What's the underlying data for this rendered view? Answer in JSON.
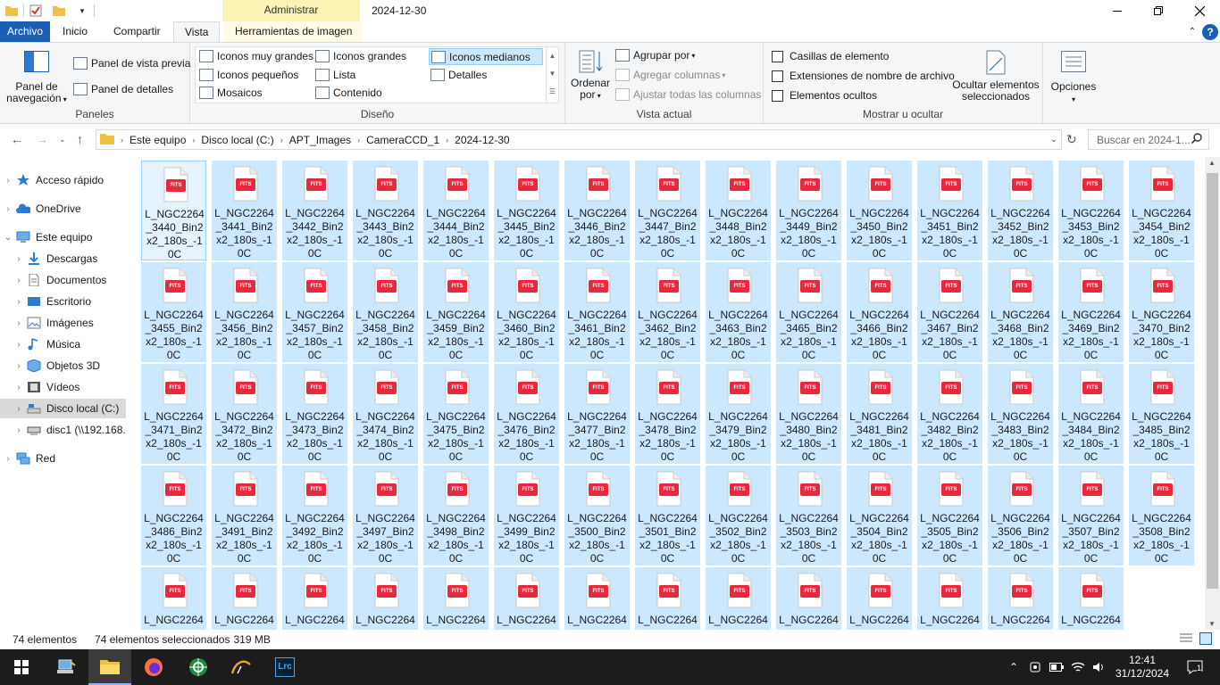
{
  "title": {
    "context_tab": "Administrar",
    "window_title": "2024-12-30"
  },
  "tabs": [
    {
      "label": "Archivo"
    },
    {
      "label": "Inicio"
    },
    {
      "label": "Compartir"
    },
    {
      "label": "Vista"
    },
    {
      "label": "Herramientas de imagen"
    }
  ],
  "ribbon": {
    "panels": {
      "label": "Paneles",
      "nav_pane": "Panel de navegación",
      "preview": "Panel de vista previa",
      "details": "Panel de detalles"
    },
    "layout": {
      "label": "Diseño",
      "items": [
        "Iconos muy grandes",
        "Iconos grandes",
        "Iconos medianos",
        "Iconos pequeños",
        "Lista",
        "Detalles",
        "Mosaicos",
        "Contenido"
      ]
    },
    "current_view": {
      "label": "Vista actual",
      "sort": "Ordenar por",
      "group": "Agrupar por",
      "add_columns": "Agregar columnas",
      "fit_columns": "Ajustar todas las columnas"
    },
    "show_hide": {
      "label": "Mostrar u ocultar",
      "checkboxes": [
        "Casillas de elemento",
        "Extensiones de nombre de archivo",
        "Elementos ocultos"
      ],
      "hide_selected": "Ocultar elementos seleccionados"
    },
    "options": "Opciones"
  },
  "address": {
    "crumbs": [
      "Este equipo",
      "Disco local (C:)",
      "APT_Images",
      "CameraCCD_1",
      "2024-12-30"
    ],
    "search_placeholder": "Buscar en 2024-1..."
  },
  "nav": [
    {
      "label": "Acceso rápido",
      "level": 0
    },
    {
      "label": "OneDrive",
      "level": 0
    },
    {
      "label": "Este equipo",
      "level": 0
    },
    {
      "label": "Descargas",
      "level": 1
    },
    {
      "label": "Documentos",
      "level": 1
    },
    {
      "label": "Escritorio",
      "level": 1
    },
    {
      "label": "Imágenes",
      "level": 1
    },
    {
      "label": "Música",
      "level": 1
    },
    {
      "label": "Objetos 3D",
      "level": 1
    },
    {
      "label": "Vídeos",
      "level": 1
    },
    {
      "label": "Disco local (C:)",
      "level": 1
    },
    {
      "label": "disc1 (\\\\192.168.",
      "level": 1
    },
    {
      "label": "Red",
      "level": 0
    }
  ],
  "file_icon_label": "FITS",
  "files": [
    "L_NGC2264_3440_Bin2x2_180s_-10C",
    "L_NGC2264_3441_Bin2x2_180s_-10C",
    "L_NGC2264_3442_Bin2x2_180s_-10C",
    "L_NGC2264_3443_Bin2x2_180s_-10C",
    "L_NGC2264_3444_Bin2x2_180s_-10C",
    "L_NGC2264_3445_Bin2x2_180s_-10C",
    "L_NGC2264_3446_Bin2x2_180s_-10C",
    "L_NGC2264_3447_Bin2x2_180s_-10C",
    "L_NGC2264_3448_Bin2x2_180s_-10C",
    "L_NGC2264_3449_Bin2x2_180s_-10C",
    "L_NGC2264_3450_Bin2x2_180s_-10C",
    "L_NGC2264_3451_Bin2x2_180s_-10C",
    "L_NGC2264_3452_Bin2x2_180s_-10C",
    "L_NGC2264_3453_Bin2x2_180s_-10C",
    "L_NGC2264_3454_Bin2x2_180s_-10C",
    "L_NGC2264_3455_Bin2x2_180s_-10C",
    "L_NGC2264_3456_Bin2x2_180s_-10C",
    "L_NGC2264_3457_Bin2x2_180s_-10C",
    "L_NGC2264_3458_Bin2x2_180s_-10C",
    "L_NGC2264_3459_Bin2x2_180s_-10C",
    "L_NGC2264_3460_Bin2x2_180s_-10C",
    "L_NGC2264_3461_Bin2x2_180s_-10C",
    "L_NGC2264_3462_Bin2x2_180s_-10C",
    "L_NGC2264_3463_Bin2x2_180s_-10C",
    "L_NGC2264_3465_Bin2x2_180s_-10C",
    "L_NGC2264_3466_Bin2x2_180s_-10C",
    "L_NGC2264_3467_Bin2x2_180s_-10C",
    "L_NGC2264_3468_Bin2x2_180s_-10C",
    "L_NGC2264_3469_Bin2x2_180s_-10C",
    "L_NGC2264_3470_Bin2x2_180s_-10C",
    "L_NGC2264_3471_Bin2x2_180s_-10C",
    "L_NGC2264_3472_Bin2x2_180s_-10C",
    "L_NGC2264_3473_Bin2x2_180s_-10C",
    "L_NGC2264_3474_Bin2x2_180s_-10C",
    "L_NGC2264_3475_Bin2x2_180s_-10C",
    "L_NGC2264_3476_Bin2x2_180s_-10C",
    "L_NGC2264_3477_Bin2x2_180s_-10C",
    "L_NGC2264_3478_Bin2x2_180s_-10C",
    "L_NGC2264_3479_Bin2x2_180s_-10C",
    "L_NGC2264_3480_Bin2x2_180s_-10C",
    "L_NGC2264_3481_Bin2x2_180s_-10C",
    "L_NGC2264_3482_Bin2x2_180s_-10C",
    "L_NGC2264_3483_Bin2x2_180s_-10C",
    "L_NGC2264_3484_Bin2x2_180s_-10C",
    "L_NGC2264_3485_Bin2x2_180s_-10C",
    "L_NGC2264_3486_Bin2x2_180s_-10C",
    "L_NGC2264_3491_Bin2x2_180s_-10C",
    "L_NGC2264_3492_Bin2x2_180s_-10C",
    "L_NGC2264_3497_Bin2x2_180s_-10C",
    "L_NGC2264_3498_Bin2x2_180s_-10C",
    "L_NGC2264_3499_Bin2x2_180s_-10C",
    "L_NGC2264_3500_Bin2x2_180s_-10C",
    "L_NGC2264_3501_Bin2x2_180s_-10C",
    "L_NGC2264_3502_Bin2x2_180s_-10C",
    "L_NGC2264_3503_Bin2x2_180s_-10C",
    "L_NGC2264_3504_Bin2x2_180s_-10C",
    "L_NGC2264_3505_Bin2x2_180s_-10C",
    "L_NGC2264_3506_Bin2x2_180s_-10C",
    "L_NGC2264_3507_Bin2x2_180s_-10C",
    "L_NGC2264_3508_Bin2x2_180s_-10C",
    "L_NGC2264",
    "L_NGC2264",
    "L_NGC2264",
    "L_NGC2264",
    "L_NGC2264",
    "L_NGC2264",
    "L_NGC2264",
    "L_NGC2264",
    "L_NGC2264",
    "L_NGC2264",
    "L_NGC2264",
    "L_NGC2264",
    "L_NGC2264",
    "L_NGC2264"
  ],
  "status": {
    "count": "74 elementos",
    "selected": "74 elementos seleccionados",
    "size": "319 MB"
  },
  "taskbar": {
    "time": "12:41",
    "date": "31/12/2024",
    "notifications": "1",
    "apps": [
      "windows-start",
      "network-app",
      "file-explorer",
      "firefox",
      "astro-app",
      "sharpcap",
      "lightroom-classic"
    ]
  }
}
